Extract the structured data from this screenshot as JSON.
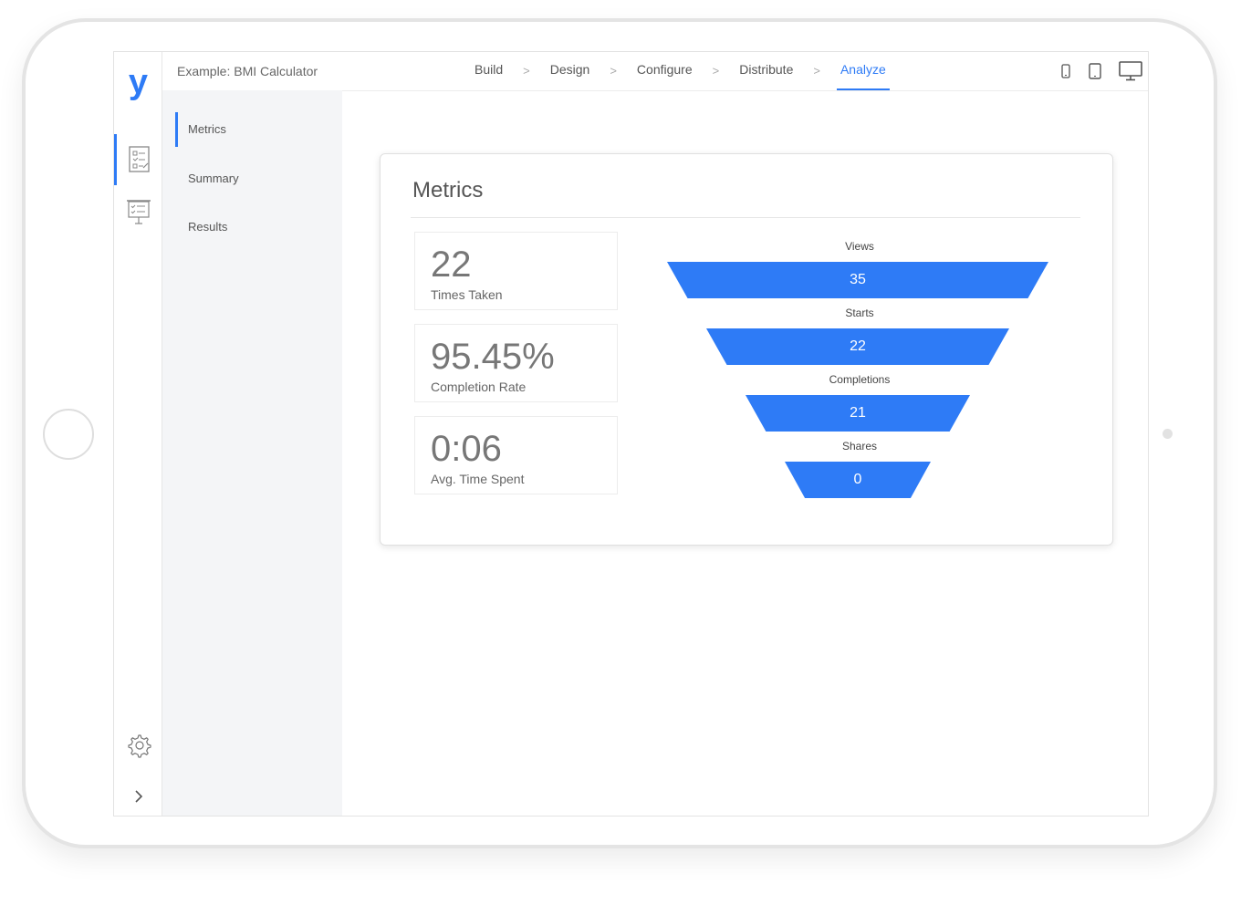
{
  "app": {
    "logo": "y",
    "title": "Example: BMI Calculator"
  },
  "steps": [
    {
      "label": "Build",
      "active": false
    },
    {
      "label": "Design",
      "active": false
    },
    {
      "label": "Configure",
      "active": false
    },
    {
      "label": "Distribute",
      "active": false
    },
    {
      "label": "Analyze",
      "active": true
    }
  ],
  "step_separator": ">",
  "devices": [
    "phone-icon",
    "tablet-icon",
    "desktop-icon"
  ],
  "rail": {
    "items": [
      {
        "icon": "analyze-checklist-icon",
        "active": true
      },
      {
        "icon": "presentation-board-icon",
        "active": false
      }
    ],
    "settings_icon": "gear-icon",
    "expand_icon": "chevron-right-icon"
  },
  "subnav": {
    "items": [
      {
        "label": "Metrics",
        "active": true
      },
      {
        "label": "Summary",
        "active": false
      },
      {
        "label": "Results",
        "active": false
      }
    ]
  },
  "metrics": {
    "title": "Metrics",
    "stats": [
      {
        "value": "22",
        "label": "Times Taken"
      },
      {
        "value": "95.45%",
        "label": "Completion Rate"
      },
      {
        "value": "0:06",
        "label": "Avg. Time Spent"
      }
    ],
    "funnel": [
      {
        "label": "Views",
        "value": "35"
      },
      {
        "label": "Starts",
        "value": "22"
      },
      {
        "label": "Completions",
        "value": "21"
      },
      {
        "label": "Shares",
        "value": "0"
      }
    ]
  },
  "colors": {
    "accent": "#2e7bf6"
  }
}
